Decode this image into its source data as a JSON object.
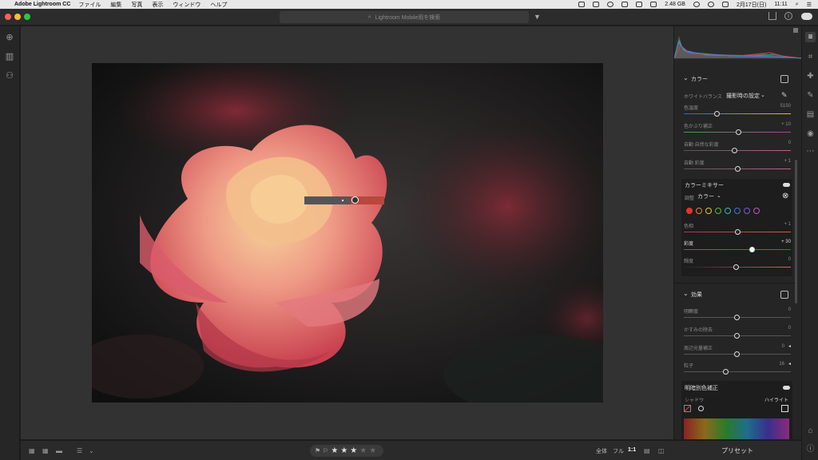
{
  "menubar": {
    "app": "Adobe Lightroom CC",
    "items": [
      "ファイル",
      "編集",
      "写真",
      "表示",
      "ウィンドウ",
      "ヘルプ"
    ],
    "storage": "2.48 GB",
    "date": "2月17日(日)",
    "time": "11:11"
  },
  "toolbar": {
    "search_placeholder": "Lightroom Mobile用を検索"
  },
  "panel": {
    "color": {
      "title": "カラー",
      "wb_label": "ホワイトバランス",
      "wb_value": "撮影時の設定",
      "temp_label": "色温度",
      "temp_value": "5150",
      "tint_label": "色かぶり補正",
      "tint_value": "+ 10",
      "vibrance_label": "自動 自然な彩度",
      "vibrance_value": "0",
      "saturation_label": "自動 彩度",
      "saturation_value": "+ 1"
    },
    "mixer": {
      "title": "カラーミキサー",
      "adjust_label": "調整",
      "adjust_value": "カラー",
      "hue_label": "色相",
      "hue_value": "+ 1",
      "sat_label": "彩度",
      "sat_value": "+ 30",
      "lum_label": "輝度",
      "lum_value": "0"
    },
    "effects": {
      "title": "効果",
      "clarity_label": "明瞭度",
      "clarity_value": "0",
      "dehaze_label": "かすみの除去",
      "dehaze_value": "0",
      "vignette_label": "周辺光量補正",
      "vignette_value": "0",
      "grain_label": "粒子",
      "grain_value": "16"
    },
    "split": {
      "title": "明暗別色補正",
      "shadow_label": "シャドウ",
      "highlight_label": "ハイライト"
    },
    "preset_label": "プリセット"
  },
  "bottombar": {
    "zoom_all": "全体",
    "zoom_full": "フル",
    "zoom_1to1": "1:1",
    "rating": 3
  },
  "colors": {
    "swatches": [
      "#e0352b",
      "#e8872a",
      "#e6c42c",
      "#51b84a",
      "#3fb6b0",
      "#3f78d6",
      "#8a55d6",
      "#c94fc4"
    ]
  }
}
